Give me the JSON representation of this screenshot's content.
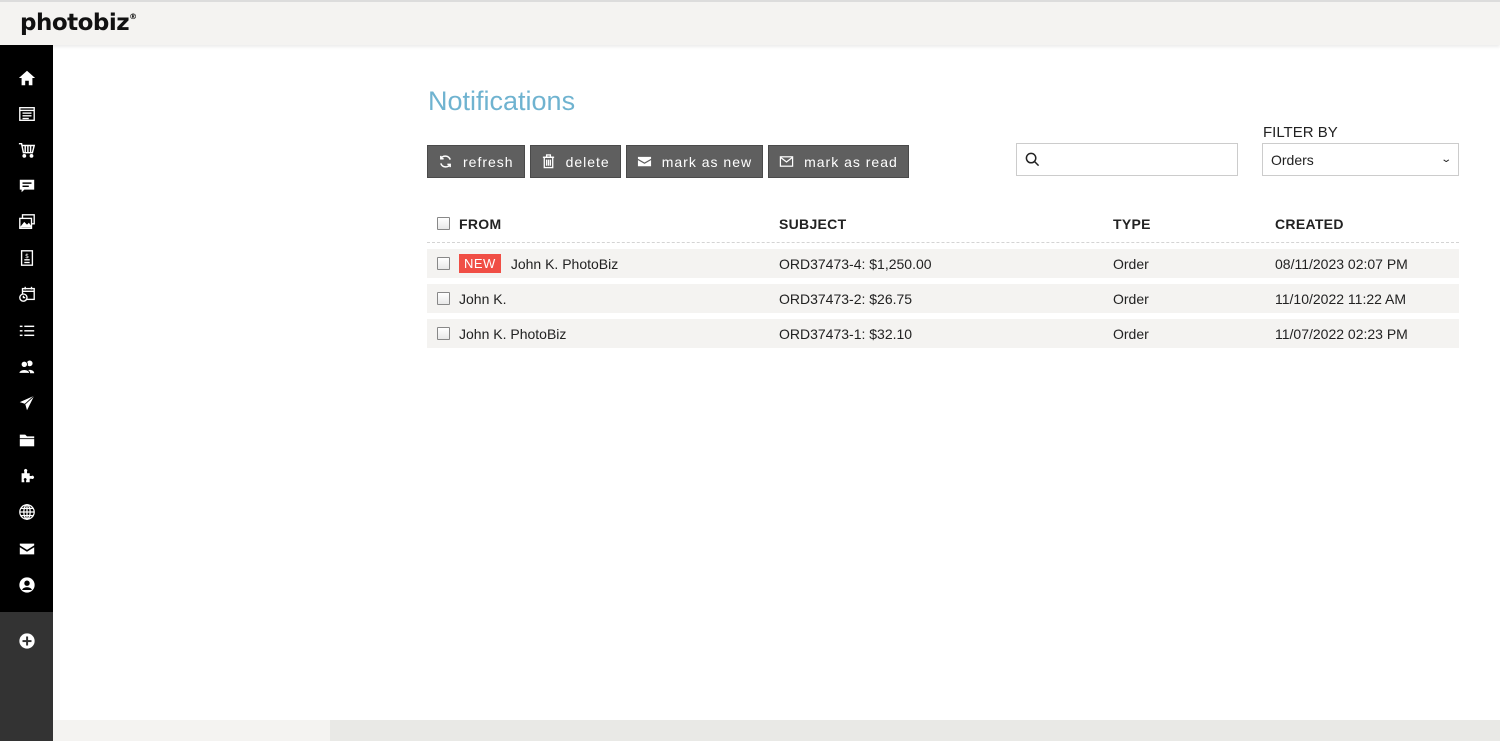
{
  "app": {
    "logo": "photobiz",
    "logo_mark": "®"
  },
  "sidebar": {
    "items": [
      {
        "name": "home",
        "icon": "home-icon"
      },
      {
        "name": "website",
        "icon": "browser-window-icon"
      },
      {
        "name": "store",
        "icon": "shopping-cart-icon"
      },
      {
        "name": "messages",
        "icon": "chat-bubble-icon"
      },
      {
        "name": "galleries",
        "icon": "images-icon"
      },
      {
        "name": "invoices",
        "icon": "invoice-icon"
      },
      {
        "name": "scheduling",
        "icon": "calendar-clock-icon"
      },
      {
        "name": "forms",
        "icon": "list-icon"
      },
      {
        "name": "contacts",
        "icon": "users-icon"
      },
      {
        "name": "marketing",
        "icon": "paper-plane-icon"
      },
      {
        "name": "files",
        "icon": "folder-icon"
      },
      {
        "name": "apps",
        "icon": "puzzle-icon"
      },
      {
        "name": "domains",
        "icon": "globe-icon"
      },
      {
        "name": "email",
        "icon": "envelope-icon"
      },
      {
        "name": "account",
        "icon": "user-circle-icon"
      }
    ],
    "add": {
      "name": "add",
      "icon": "plus-circle-icon"
    }
  },
  "page": {
    "title": "Notifications"
  },
  "toolbar": {
    "refresh_label": "refresh",
    "delete_label": "delete",
    "mark_new_label": "mark as new",
    "mark_read_label": "mark as read"
  },
  "search": {
    "value": "",
    "placeholder": ""
  },
  "filter": {
    "label": "FILTER BY",
    "selected": "Orders"
  },
  "table": {
    "columns": [
      "FROM",
      "SUBJECT",
      "TYPE",
      "CREATED"
    ],
    "rows": [
      {
        "badge": "NEW",
        "from": "John K. PhotoBiz",
        "subject": "ORD37473-4: $1,250.00",
        "type": "Order",
        "created": "08/11/2023 02:07 PM"
      },
      {
        "badge": null,
        "from": "John K.",
        "subject": "ORD37473-2: $26.75",
        "type": "Order",
        "created": "11/10/2022 11:22 AM"
      },
      {
        "badge": null,
        "from": "John K. PhotoBiz",
        "subject": "ORD37473-1: $32.10",
        "type": "Order",
        "created": "11/07/2022 02:23 PM"
      }
    ]
  },
  "colors": {
    "title": "#6fb3d0",
    "button_bg": "#5f5f5f",
    "new_badge": "#f04e45",
    "sidebar_bg": "#000000",
    "row_bg": "#f4f3f1"
  }
}
